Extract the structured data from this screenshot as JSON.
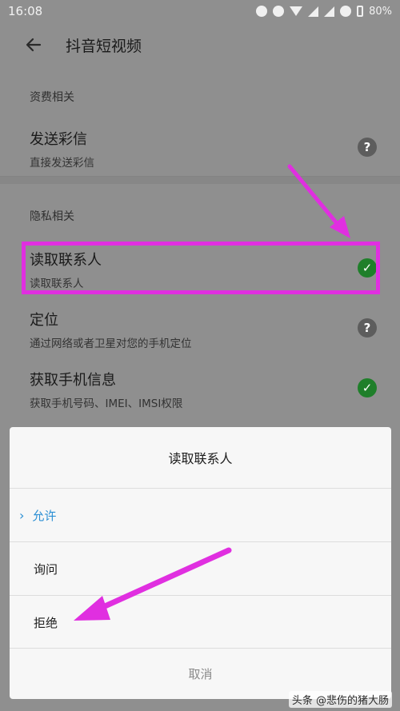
{
  "status_bar": {
    "time": "16:08",
    "battery": "80%"
  },
  "header": {
    "title": "抖音短视频"
  },
  "sections": {
    "billing": {
      "label": "资费相关",
      "items": [
        {
          "title": "发送彩信",
          "subtitle": "直接发送彩信",
          "state": "?"
        }
      ]
    },
    "privacy": {
      "label": "隐私相关",
      "items": [
        {
          "title": "读取联系人",
          "subtitle": "读取联系人",
          "state": "✓"
        },
        {
          "title": "定位",
          "subtitle": "通过网络或者卫星对您的手机定位",
          "state": "?"
        },
        {
          "title": "获取手机信息",
          "subtitle": "获取手机号码、IMEI、IMSI权限",
          "state": "✓"
        }
      ]
    }
  },
  "dialog": {
    "title": "读取联系人",
    "options": [
      {
        "label": "允许",
        "selected": true
      },
      {
        "label": "询问",
        "selected": false
      },
      {
        "label": "拒绝",
        "selected": false
      }
    ],
    "cancel": "取消"
  },
  "watermark": "头条 @悲伤的猪大肠",
  "colors": {
    "highlight": "#e02fe0",
    "ok": "#1f7f2a",
    "accent": "#2b8fd4"
  }
}
